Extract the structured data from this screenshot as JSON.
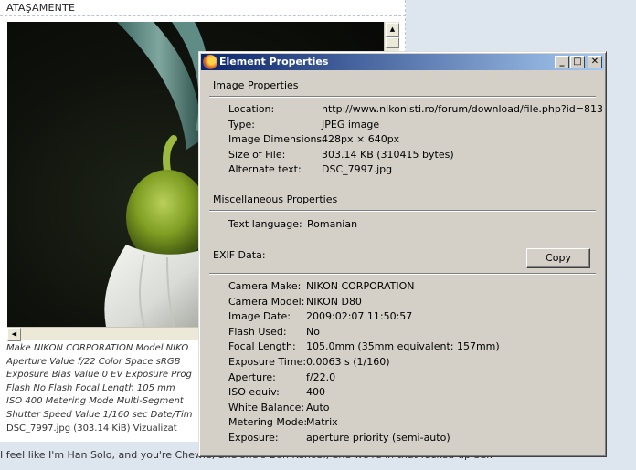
{
  "forum": {
    "attachments_title": "ATAŞAMENTE",
    "exif_lines": [
      "Make NIKON CORPORATION Model NIKO",
      "Aperture Value f/22 Color Space sRGB",
      "Exposure Bias Value 0 EV Exposure Prog",
      "Flash No Flash Focal Length 105 mm",
      "ISO 400 Metering Mode Multi-Segment",
      "Shutter Speed Value 1/160 sec Date/Tim"
    ],
    "file_line": "DSC_7997.jpg (303.14 KiB) Vizualizat",
    "quote": "I feel like I'm Han Solo, and you're Chewie, and she's Ben Kenobi, and we're in that fucked-up bar."
  },
  "dialog": {
    "title": "Element Properties",
    "controls": {
      "minimize": "_",
      "maximize": "□",
      "close": "✕"
    },
    "image_section": "Image Properties",
    "image_props": [
      {
        "key": "Location:",
        "value": "http://www.nikonisti.ro/forum/download/file.php?id=813"
      },
      {
        "key": "Type:",
        "value": "JPEG image"
      },
      {
        "key": "Image Dimensions:",
        "value": "428px × 640px"
      },
      {
        "key": "Size of File:",
        "value": "303.14 KB (310415 bytes)"
      },
      {
        "key": "Alternate text:",
        "value": "DSC_7997.jpg"
      }
    ],
    "misc_section": "Miscellaneous Properties",
    "misc_props": [
      {
        "key": "Text language:",
        "value": "Romanian"
      }
    ],
    "exif_section": "EXIF Data:",
    "copy_label": "Copy",
    "exif_props": [
      {
        "key": "Camera Make:",
        "value": "NIKON CORPORATION"
      },
      {
        "key": "Camera Model:",
        "value": "NIKON D80"
      },
      {
        "key": "Image Date:",
        "value": "2009:02:07 11:50:57"
      },
      {
        "key": "Flash Used:",
        "value": "No"
      },
      {
        "key": "Focal Length:",
        "value": "105.0mm (35mm equivalent: 157mm)"
      },
      {
        "key": "Exposure Time:",
        "value": "0.0063 s (1/160)"
      },
      {
        "key": "Aperture:",
        "value": "f/22.0"
      },
      {
        "key": "ISO equiv:",
        "value": "400"
      },
      {
        "key": "White Balance:",
        "value": "Auto"
      },
      {
        "key": "Metering Mode:",
        "value": "Matrix"
      },
      {
        "key": "Exposure:",
        "value": "aperture priority (semi-auto)"
      }
    ]
  },
  "colors": {
    "titlebar_start": "#0a246a",
    "titlebar_end": "#a6caf0",
    "dialog_face": "#d4d0c8",
    "page_background": "#dde5ee"
  }
}
